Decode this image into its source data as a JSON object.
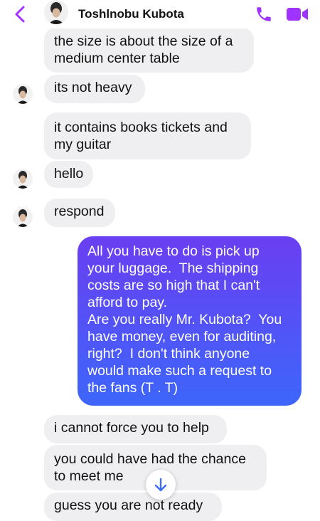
{
  "header": {
    "contact_name": "Toshlnobu Kubota",
    "icons": {
      "back": "chevron-left-icon",
      "call": "phone-icon",
      "video": "video-camera-icon"
    },
    "accent_color": "#a033ff"
  },
  "messages": [
    {
      "from": "contact",
      "text": "the size is about the size of a\nmedium center table"
    },
    {
      "from": "contact",
      "text": "its not heavy"
    },
    {
      "from": "contact",
      "text": "it contains books tickets and\nmy guitar"
    },
    {
      "from": "contact",
      "text": "hello"
    },
    {
      "from": "contact",
      "text": "respond"
    },
    {
      "from": "me",
      "text": "All you have to do is pick up\nyour luggage.  The shipping\ncosts are so high that I can't\nafford to pay.\nAre you really Mr. Kubota?  You\nhave money, even for auditing,\nright?  I don't think anyone\nwould make such a request to\nthe fans (T . T)"
    },
    {
      "from": "contact",
      "text": "i cannot force you to help"
    },
    {
      "from": "contact",
      "text": "you could have had the chance\nto meet me"
    },
    {
      "from": "contact",
      "text": "guess you are not ready"
    }
  ],
  "scroll_button": {
    "icon": "arrow-down-icon"
  },
  "colors": {
    "incoming_bubble": "#efeff1",
    "outgoing_gradient_top": "#6a3ef2",
    "outgoing_gradient_bottom": "#3d66fb"
  }
}
